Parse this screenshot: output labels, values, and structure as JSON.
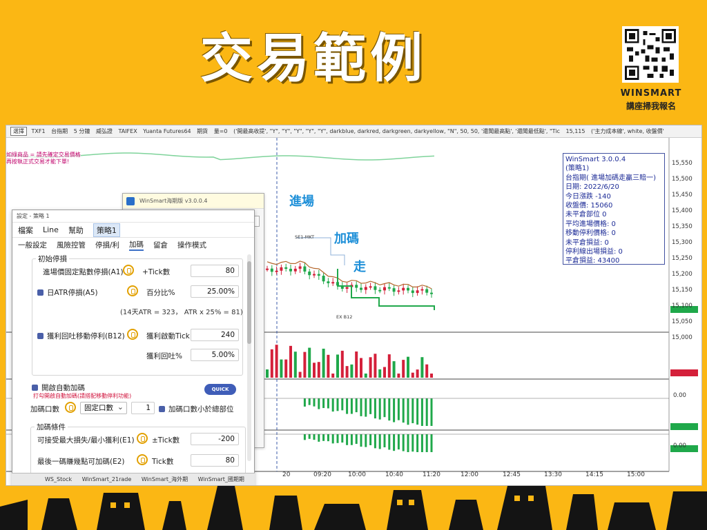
{
  "banner": {
    "title": "交易範例",
    "brand": "WINSMART",
    "cta": "講座掃我報名"
  },
  "chart_toolbar": {
    "items": [
      "選擇",
      "TXF1",
      "台指期",
      "5 分鐘",
      "威弘證",
      "TAIFEX",
      "Yuanta Futures64",
      "期貨",
      "量=0",
      "('開最高收提', \"Y\", \"Y\", \"Y\", \"Y\", \"Y\", darkblue, darkred, darkgreen, darkyellow, \"N\", 50, 50, '還聞最高點', '還聞最低點', \"Tic",
      "15,115",
      "('主力成本線', white, 收盤價'"
    ]
  },
  "red_note": [
    "如綠商品 = 請先確定交易價格",
    "再按執正式交易才能下單!"
  ],
  "annotations": {
    "entry": "進場",
    "add": "加碼",
    "exit": "走",
    "se_mkt": "SE1-MKT",
    "ex_b12": "EX B12"
  },
  "info_box": {
    "lines": [
      "WinSmart 3.0.0.4",
      "(策略1)",
      "台指期( 進場加碼走贏三賠一)",
      "日期: 2022/6/20",
      "今日漲跌 -140",
      "收盤價: 15060",
      "未平倉部位 0",
      "平均進場價格: 0",
      "移動停利價格: 0",
      "未平倉損益: 0",
      "停利線出場損益: 0",
      "平倉損益: 43400"
    ]
  },
  "price_axis": [
    "15,550",
    "15,500",
    "15,450",
    "15,400",
    "15,350",
    "15,300",
    "15,250",
    "15,200",
    "15,150",
    "15,100",
    "15,050",
    "15,000"
  ],
  "lower_labels": [
    "0.00",
    "0.00"
  ],
  "time_axis": [
    "20",
    "09:20",
    "10:00",
    "10:40",
    "11:20",
    "12:00",
    "12:45",
    "13:30",
    "14:15",
    "15:00"
  ],
  "bg_window": {
    "title": "WinSmart海期版 v3.0.0.4",
    "value": "0"
  },
  "dialog": {
    "title": "設定 - 策略 1",
    "menu": [
      "檔案",
      "Line",
      "幫助",
      "策略1"
    ],
    "tabs": [
      "一般設定",
      "風險控管",
      "停損/利",
      "加碼",
      "留倉",
      "操作模式"
    ],
    "initial_stop": {
      "group_label": "初始停損",
      "fixed_label": "進場價固定點數停損(A1)",
      "fixed_unit": "+Tick數",
      "fixed_value": "80",
      "atr_label": "日ATR停損(A5)",
      "atr_unit": "百分比%",
      "atr_value": "25.00%",
      "atr_hint": "(14天ATR = 323， ATR x 25% = 81)",
      "trail_label": "獲利回吐移動停利(B12)",
      "trail_start_label": "獲利啟動Tick",
      "trail_start_value": "240",
      "trail_back_label": "獲利回吐%",
      "trail_back_value": "5.00%"
    },
    "auto_add": {
      "label": "開啟自動加碼",
      "note": "打勾開啟自動加碼(請搭配移動停利功能)",
      "quick": "QUICK",
      "lots_label": "加碼口數",
      "lots_mode": "固定口數",
      "lots_value": "1",
      "lots_check": "加碼口數小於總部位"
    },
    "add_conditions": {
      "group_label": "加碼條件",
      "e1_label": "可接受最大損失/最小獲利(E1)",
      "e1_unit": "±Tick數",
      "e1_value": "-200",
      "e2_label": "最後一碼賺幾點可加碼(E2)",
      "e2_unit": "Tick數",
      "e2_value": "80"
    }
  },
  "taskbar": [
    "WS_Stock",
    "WinSmart_21rade",
    "WinSmart_海外期",
    "WinSmart_國期期"
  ],
  "colors": {
    "background": "#fbb714",
    "bull": "#1fa84a",
    "bear": "#d4203a",
    "annot": "#1d8fd8"
  }
}
